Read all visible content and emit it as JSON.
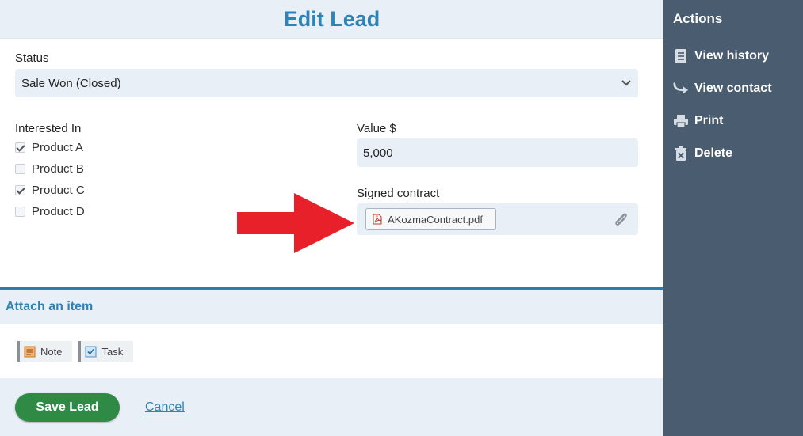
{
  "header": {
    "title": "Edit Lead"
  },
  "status": {
    "label": "Status",
    "value": "Sale Won (Closed)"
  },
  "interested": {
    "label": "Interested In",
    "items": [
      {
        "label": "Product A",
        "checked": true
      },
      {
        "label": "Product B",
        "checked": false
      },
      {
        "label": "Product C",
        "checked": true
      },
      {
        "label": "Product D",
        "checked": false
      }
    ]
  },
  "value": {
    "label": "Value $",
    "amount": "5,000"
  },
  "contract": {
    "label": "Signed contract",
    "file_name": "AKozmaContract.pdf"
  },
  "attach": {
    "title": "Attach an item",
    "items": [
      {
        "label": "Note",
        "icon": "note-icon"
      },
      {
        "label": "Task",
        "icon": "task-icon"
      }
    ]
  },
  "footer": {
    "save_label": "Save Lead",
    "cancel_label": "Cancel"
  },
  "sidebar": {
    "title": "Actions",
    "items": [
      {
        "label": "View history",
        "icon": "document-icon"
      },
      {
        "label": "View contact",
        "icon": "share-arrow-icon"
      },
      {
        "label": "Print",
        "icon": "printer-icon"
      },
      {
        "label": "Delete",
        "icon": "trash-icon"
      }
    ]
  },
  "colors": {
    "accent": "#2f83b4",
    "save": "#2f8a46",
    "sidebar": "#4a5c70",
    "arrow": "#e8202a"
  }
}
